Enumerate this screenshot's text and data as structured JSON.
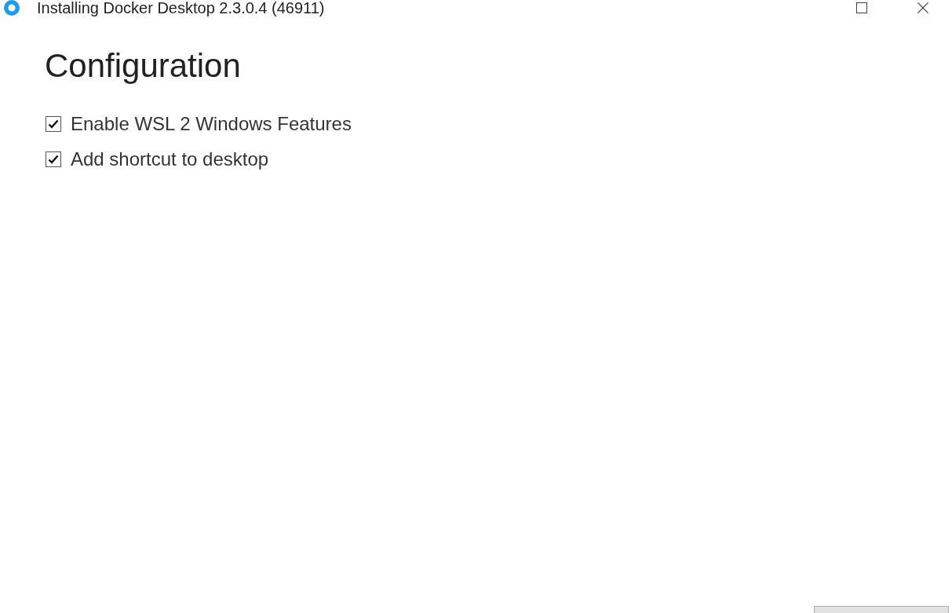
{
  "window": {
    "title": "Installing Docker Desktop 2.3.0.4 (46911)"
  },
  "heading": "Configuration",
  "options": [
    {
      "label": "Enable WSL 2 Windows Features",
      "checked": true
    },
    {
      "label": "Add shortcut to desktop",
      "checked": true
    }
  ]
}
